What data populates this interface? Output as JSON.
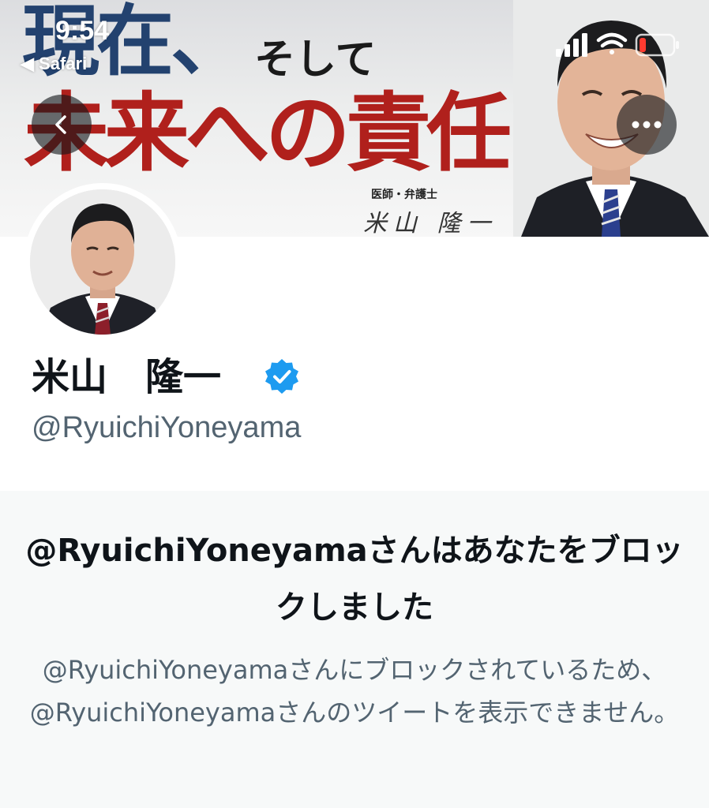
{
  "status_bar": {
    "time": "9:54",
    "back_app": "◀ Safari"
  },
  "banner": {
    "headline_line1": "現在、",
    "headline_connector": "そして",
    "headline_line2": "未来への責任",
    "caption": "医師・弁護士",
    "signature": "米山 隆一"
  },
  "profile": {
    "display_name": "米山　隆一",
    "handle": "@RyuichiYoneyama",
    "verified": true
  },
  "blocked": {
    "title": "@RyuichiYoneyamaさんはあなたをブロックしました",
    "description": "@RyuichiYoneyamaさんにブロックされているため、@RyuichiYoneyamaさんのツイートを表示できません。"
  },
  "colors": {
    "accent_blue": "#1d9bf0",
    "headline_navy": "#23426f",
    "headline_red": "#b0201c",
    "secondary_text": "#536471",
    "panel_bg": "#f7f9f9"
  },
  "icons": {
    "back": "chevron-left-icon",
    "more": "more-horizontal-icon",
    "verified": "verified-badge-icon",
    "signal": "cellular-signal-icon",
    "wifi": "wifi-icon",
    "battery": "battery-icon"
  }
}
